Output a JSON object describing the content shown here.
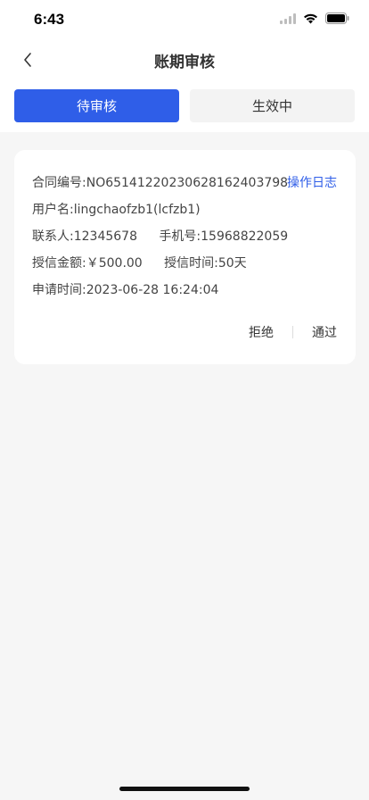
{
  "status_bar": {
    "time": "6:43"
  },
  "nav": {
    "title": "账期审核",
    "back_icon": "chevron-left-icon"
  },
  "tabs": [
    {
      "label": "待审核",
      "active": true
    },
    {
      "label": "生效中",
      "active": false
    }
  ],
  "card": {
    "contract_no": "合同编号:NO65141220230628162403798",
    "log_link": "操作日志",
    "username": "用户名:lingchaofzb1(lcfzb1)",
    "contact": "联系人:12345678",
    "phone": "手机号:15968822059",
    "credit_amount": "授信金额:￥500.00",
    "credit_time": "授信时间:50天",
    "apply_time": "申请时间:2023-06-28 16:24:04",
    "reject_label": "拒绝",
    "approve_label": "通过"
  },
  "colors": {
    "accent": "#2f5ee8",
    "background": "#f6f6f6"
  }
}
